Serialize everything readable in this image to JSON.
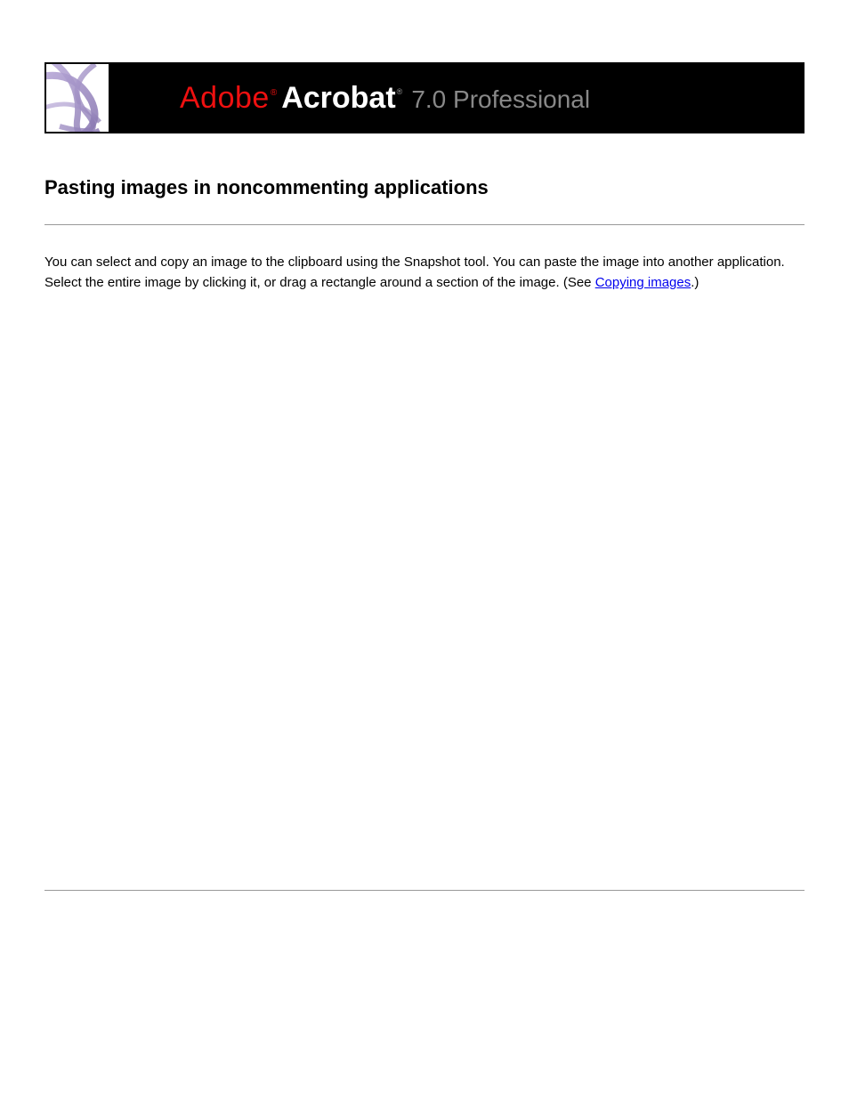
{
  "banner": {
    "adobe": "Adobe",
    "acrobat": "Acrobat",
    "reg_symbol": "®",
    "version": "7.0 Professional",
    "icon_name": "acrobat-abstract-icon"
  },
  "content": {
    "title": "Pasting images in noncommenting applications",
    "paragraph_before_link": "You can select and copy an image to the clipboard using the Snapshot tool. You can paste the image into another application. Select the entire image by clicking it, or drag a rectangle around a section of the image. (See ",
    "link_text": "Copying images",
    "paragraph_after_link": ".)"
  }
}
